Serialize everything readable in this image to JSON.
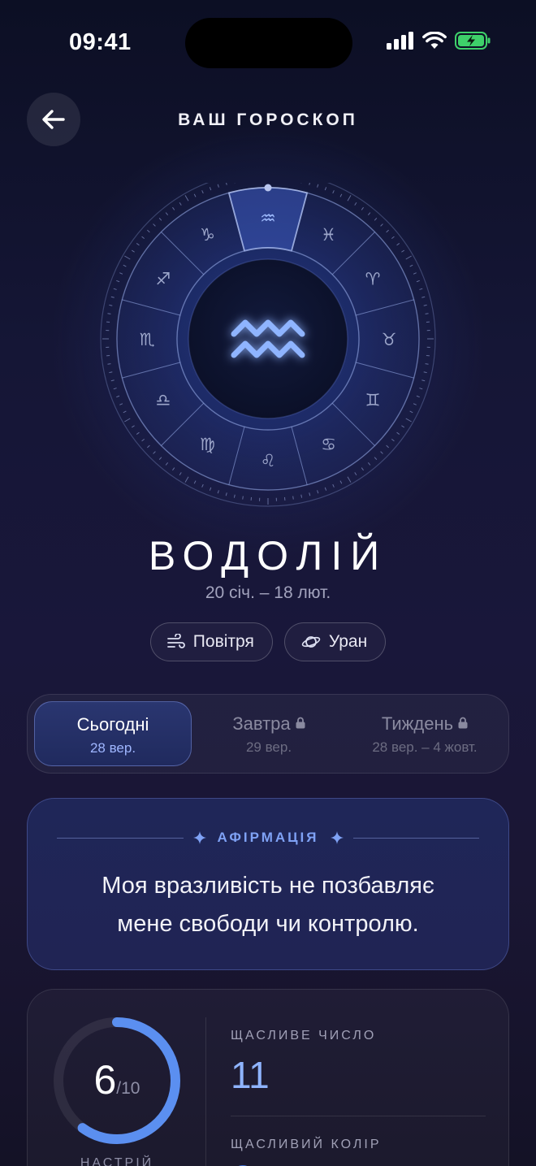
{
  "status": {
    "time": "09:41"
  },
  "header": {
    "title": "ВАШ ГОРОСКОП"
  },
  "sign": {
    "name": "ВОДОЛІЙ",
    "dates": "20 січ. – 18 лют."
  },
  "chips": [
    {
      "icon": "wind-icon",
      "label": "Повітря"
    },
    {
      "icon": "planet-icon",
      "label": "Уран"
    }
  ],
  "tabs": [
    {
      "label": "Сьогодні",
      "date": "28 вер.",
      "active": true,
      "locked": false
    },
    {
      "label": "Завтра",
      "date": "29 вер.",
      "active": false,
      "locked": true
    },
    {
      "label": "Тиждень",
      "date": "28 вер. – 4 жовт.",
      "active": false,
      "locked": true
    }
  ],
  "affirmation": {
    "label": "АФІРМАЦІЯ",
    "text_line1": "Моя вразливість не позбавляє",
    "text_line2": "мене свободи чи контролю."
  },
  "stats": {
    "mood_value": "6",
    "mood_max": "/10",
    "mood_fraction": 0.6,
    "mood_label": "НАСТРІЙ",
    "lucky_number_label": "ЩАСЛИВЕ ЧИСЛО",
    "lucky_number": "11",
    "lucky_color_label": "ЩАСЛИВИЙ КОЛІР"
  },
  "colors": {
    "accent": "#6e9cf6",
    "ring": "#5b8ff0",
    "background": "#151636"
  }
}
